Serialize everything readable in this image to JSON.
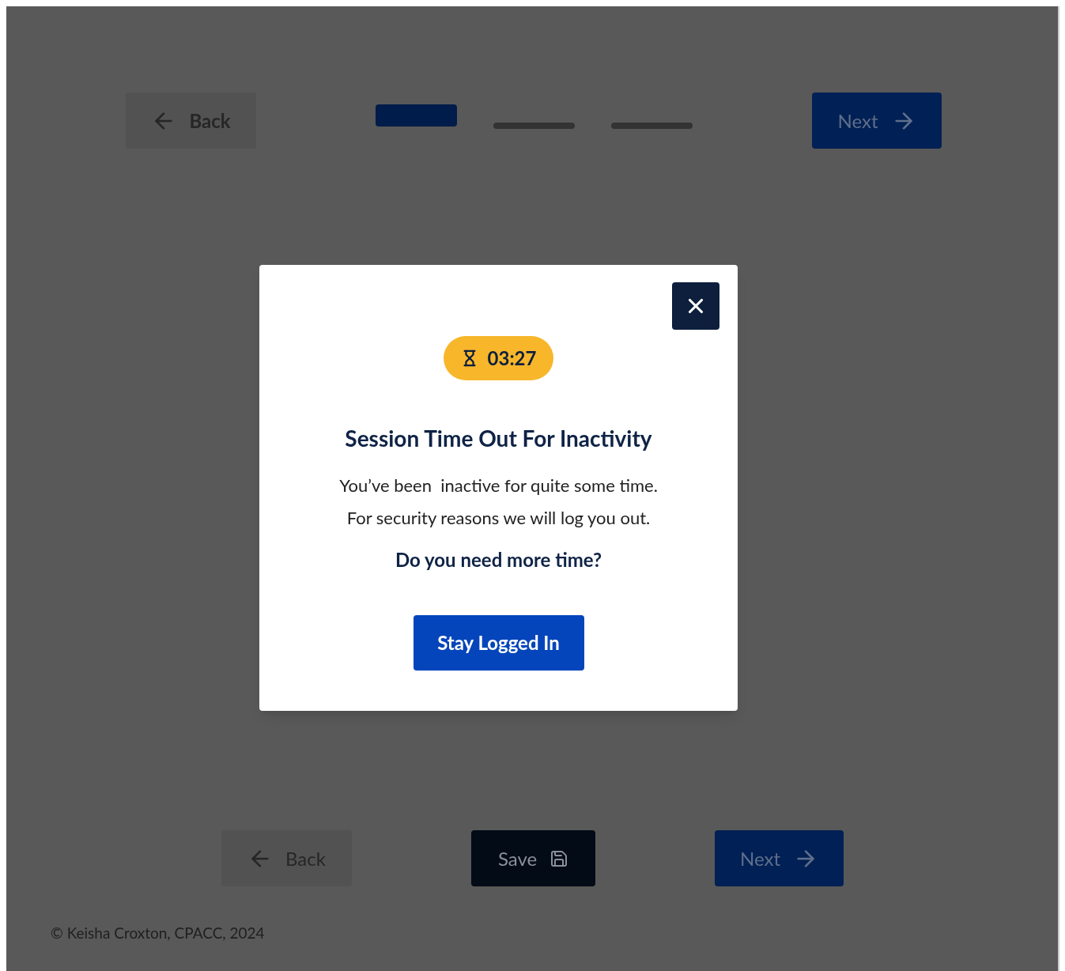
{
  "top_nav": {
    "back": "Back",
    "next": "Next",
    "steps": [
      {
        "selected": true
      },
      {
        "selected": false
      },
      {
        "selected": false
      }
    ]
  },
  "dialog": {
    "timer": "03:27",
    "title": "Session Time Out For Inactivity",
    "message_lines": [
      "You’ve been  inactive for quite some time.",
      "For security reasons we will log you out."
    ],
    "question": "Do you need more time?",
    "button": "Stay Logged In"
  },
  "bottom_nav": {
    "back": "Back",
    "save": "Save",
    "next": "Next"
  },
  "footer": "© Keisha Croxton, CPACC, 2024"
}
